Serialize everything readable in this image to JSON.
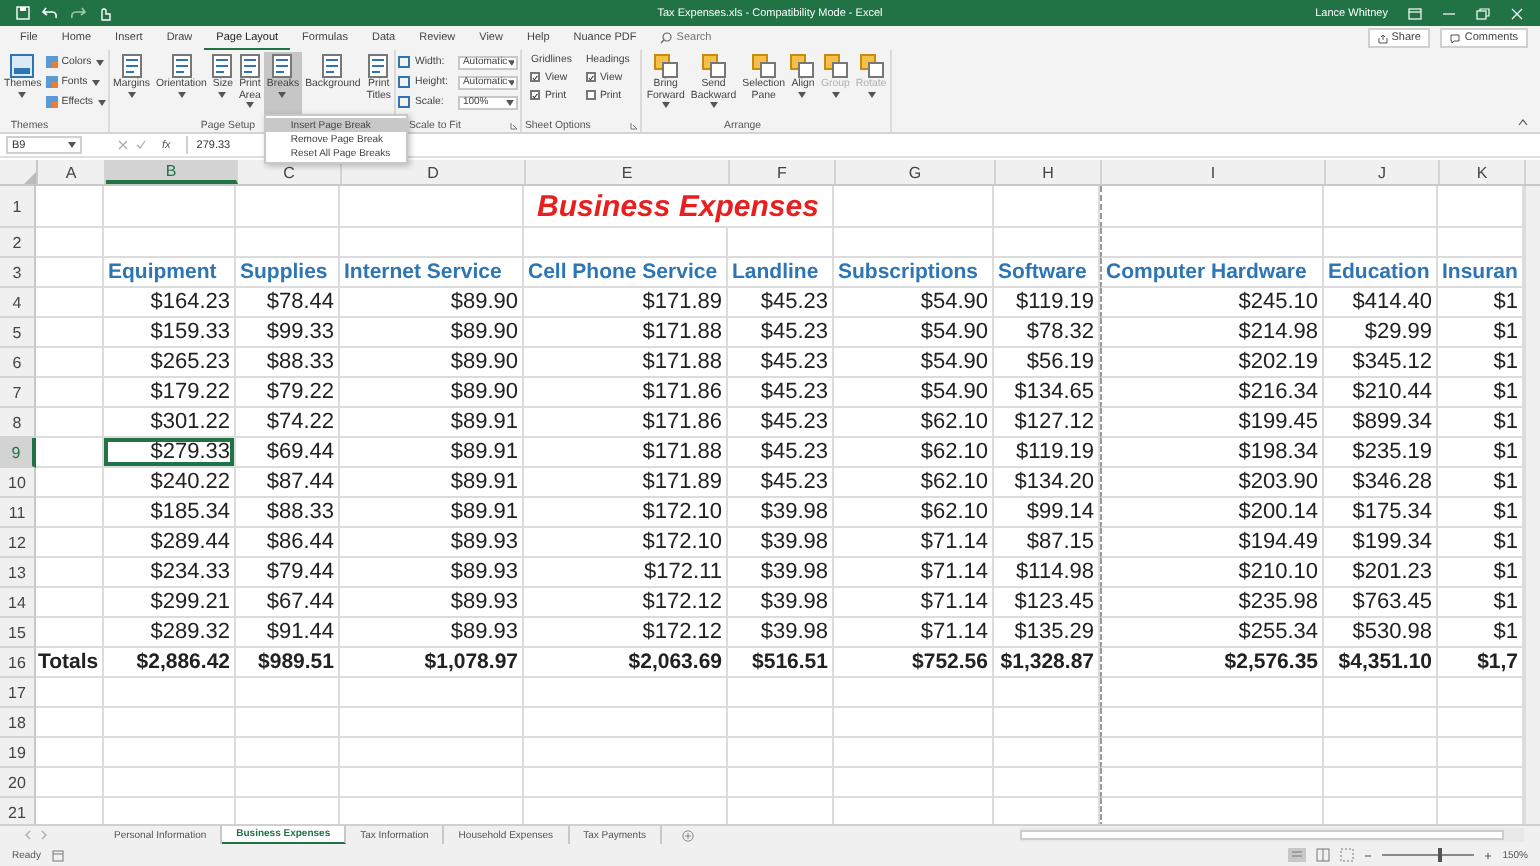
{
  "window": {
    "title": "Tax Expenses.xls  -  Compatibility Mode  -  Excel",
    "user": "Lance Whitney"
  },
  "menu_tabs": [
    {
      "label": "File",
      "selected": false
    },
    {
      "label": "Home",
      "selected": false
    },
    {
      "label": "Insert",
      "selected": false
    },
    {
      "label": "Draw",
      "selected": false
    },
    {
      "label": "Page Layout",
      "selected": true
    },
    {
      "label": "Formulas",
      "selected": false
    },
    {
      "label": "Data",
      "selected": false
    },
    {
      "label": "Review",
      "selected": false
    },
    {
      "label": "View",
      "selected": false
    },
    {
      "label": "Help",
      "selected": false
    },
    {
      "label": "Nuance PDF",
      "selected": false
    }
  ],
  "search": {
    "placeholder": "Search"
  },
  "share_button": "Share",
  "comments_button": "Comments",
  "ribbon": {
    "groups": [
      {
        "label": "Themes",
        "launcher": false,
        "items": [
          {
            "kind": "large",
            "label": "Themes",
            "has_menu": true,
            "selected": false,
            "disabled": false
          },
          {
            "kind": "small",
            "label": "Colors",
            "has_menu": true
          },
          {
            "kind": "small",
            "label": "Fonts",
            "has_menu": true
          },
          {
            "kind": "small",
            "label": "Effects",
            "has_menu": true
          }
        ]
      },
      {
        "label": "Page Setup",
        "launcher": false,
        "items": [
          {
            "kind": "large",
            "label": "Margins",
            "has_menu": true,
            "selected": false,
            "disabled": false
          },
          {
            "kind": "large",
            "label": "Orientation",
            "has_menu": true,
            "selected": false,
            "disabled": false
          },
          {
            "kind": "large",
            "label": "Size",
            "has_menu": true,
            "selected": false,
            "disabled": false
          },
          {
            "kind": "large",
            "label": "Print Area",
            "has_menu": true,
            "selected": false,
            "disabled": false
          },
          {
            "kind": "large",
            "label": "Breaks",
            "has_menu": true,
            "selected": true,
            "disabled": false
          },
          {
            "kind": "large",
            "label": "Background",
            "has_menu": false,
            "selected": false,
            "disabled": false
          },
          {
            "kind": "large",
            "label": "Print Titles",
            "has_menu": false,
            "selected": false,
            "disabled": false
          }
        ]
      },
      {
        "label": "Scale to Fit",
        "launcher": true,
        "items": [
          {
            "kind": "spin",
            "label": "Width:",
            "value": "Automatic"
          },
          {
            "kind": "spin",
            "label": "Height:",
            "value": "Automatic"
          },
          {
            "kind": "spin",
            "label": "Scale:",
            "value": "100%"
          }
        ]
      },
      {
        "label": "Sheet Options",
        "launcher": true,
        "items": [
          {
            "kind": "checkgroup",
            "label": "Gridlines",
            "checks": [
              {
                "label": "View",
                "checked": true
              },
              {
                "label": "Print",
                "checked": true
              }
            ]
          },
          {
            "kind": "checkgroup",
            "label": "Headings",
            "checks": [
              {
                "label": "View",
                "checked": true
              },
              {
                "label": "Print",
                "checked": false
              }
            ]
          }
        ]
      },
      {
        "label": "Arrange",
        "launcher": false,
        "items": [
          {
            "kind": "large",
            "label": "Bring Forward",
            "has_menu": true,
            "selected": false,
            "disabled": false
          },
          {
            "kind": "large",
            "label": "Send Backward",
            "has_menu": true,
            "selected": false,
            "disabled": false
          },
          {
            "kind": "large",
            "label": "Selection Pane",
            "has_menu": false,
            "selected": false,
            "disabled": false
          },
          {
            "kind": "large",
            "label": "Align",
            "has_menu": true,
            "selected": false,
            "disabled": false
          },
          {
            "kind": "large",
            "label": "Group",
            "has_menu": true,
            "selected": false,
            "disabled": true
          },
          {
            "kind": "large",
            "label": "Rotate",
            "has_menu": true,
            "selected": false,
            "disabled": true
          }
        ]
      }
    ]
  },
  "breaks_menu": [
    {
      "label": "Insert Page Break",
      "selected": true
    },
    {
      "label": "Remove Page Break",
      "selected": false
    },
    {
      "label": "Reset All Page Breaks",
      "selected": false
    }
  ],
  "formula_bar": {
    "cell_ref": "B9",
    "function_label": "fx",
    "value": "279.33"
  },
  "sheet": {
    "columns": [
      {
        "letter": "A",
        "selected": false
      },
      {
        "letter": "B",
        "selected": true
      },
      {
        "letter": "C",
        "selected": false
      },
      {
        "letter": "D",
        "selected": false
      },
      {
        "letter": "E",
        "selected": false
      },
      {
        "letter": "F",
        "selected": false
      },
      {
        "letter": "G",
        "selected": false
      },
      {
        "letter": "H",
        "selected": false
      },
      {
        "letter": "I",
        "selected": false
      },
      {
        "letter": "J",
        "selected": false
      },
      {
        "letter": "K",
        "selected": false
      }
    ],
    "rows": [
      {
        "number": "1",
        "kind": "title",
        "selected": false,
        "title": "Business Expenses"
      },
      {
        "number": "2",
        "kind": "empty",
        "selected": false
      },
      {
        "number": "3",
        "kind": "header",
        "selected": false,
        "cells": [
          "Equipment",
          "Supplies",
          "Internet Service",
          "Cell Phone Service",
          "Landline",
          "Subscriptions",
          "Software",
          "Computer Hardware",
          "Education",
          "Insuran"
        ]
      },
      {
        "number": "4",
        "kind": "data",
        "selected": false,
        "cells": [
          "$164.23",
          "$78.44",
          "$89.90",
          "$171.89",
          "$45.23",
          "$54.90",
          "$119.19",
          "$245.10",
          "$414.40",
          "$1"
        ]
      },
      {
        "number": "5",
        "kind": "data",
        "selected": false,
        "cells": [
          "$159.33",
          "$99.33",
          "$89.90",
          "$171.88",
          "$45.23",
          "$54.90",
          "$78.32",
          "$214.98",
          "$29.99",
          "$1"
        ]
      },
      {
        "number": "6",
        "kind": "data",
        "selected": false,
        "cells": [
          "$265.23",
          "$88.33",
          "$89.90",
          "$171.88",
          "$45.23",
          "$54.90",
          "$56.19",
          "$202.19",
          "$345.12",
          "$1"
        ]
      },
      {
        "number": "7",
        "kind": "data",
        "selected": false,
        "cells": [
          "$179.22",
          "$79.22",
          "$89.90",
          "$171.86",
          "$45.23",
          "$54.90",
          "$134.65",
          "$216.34",
          "$210.44",
          "$1"
        ]
      },
      {
        "number": "8",
        "kind": "data",
        "selected": false,
        "cells": [
          "$301.22",
          "$74.22",
          "$89.91",
          "$171.86",
          "$45.23",
          "$62.10",
          "$127.12",
          "$199.45",
          "$899.34",
          "$1"
        ]
      },
      {
        "number": "9",
        "kind": "data",
        "selected": true,
        "cells": [
          "$279.33",
          "$69.44",
          "$89.91",
          "$171.88",
          "$45.23",
          "$62.10",
          "$119.19",
          "$198.34",
          "$235.19",
          "$1"
        ]
      },
      {
        "number": "10",
        "kind": "data",
        "selected": false,
        "cells": [
          "$240.22",
          "$87.44",
          "$89.91",
          "$171.89",
          "$45.23",
          "$62.10",
          "$134.20",
          "$203.90",
          "$346.28",
          "$1"
        ]
      },
      {
        "number": "11",
        "kind": "data",
        "selected": false,
        "cells": [
          "$185.34",
          "$88.33",
          "$89.91",
          "$172.10",
          "$39.98",
          "$62.10",
          "$99.14",
          "$200.14",
          "$175.34",
          "$1"
        ]
      },
      {
        "number": "12",
        "kind": "data",
        "selected": false,
        "cells": [
          "$289.44",
          "$86.44",
          "$89.93",
          "$172.10",
          "$39.98",
          "$71.14",
          "$87.15",
          "$194.49",
          "$199.34",
          "$1"
        ]
      },
      {
        "number": "13",
        "kind": "data",
        "selected": false,
        "cells": [
          "$234.33",
          "$79.44",
          "$89.93",
          "$172.11",
          "$39.98",
          "$71.14",
          "$114.98",
          "$210.10",
          "$201.23",
          "$1"
        ]
      },
      {
        "number": "14",
        "kind": "data",
        "selected": false,
        "cells": [
          "$299.21",
          "$67.44",
          "$89.93",
          "$172.12",
          "$39.98",
          "$71.14",
          "$123.45",
          "$235.98",
          "$763.45",
          "$1"
        ]
      },
      {
        "number": "15",
        "kind": "data",
        "selected": false,
        "cells": [
          "$289.32",
          "$91.44",
          "$89.93",
          "$172.12",
          "$39.98",
          "$71.14",
          "$135.29",
          "$255.34",
          "$530.98",
          "$1"
        ]
      },
      {
        "number": "16",
        "kind": "total",
        "selected": false,
        "label": "Totals",
        "cells": [
          "$2,886.42",
          "$989.51",
          "$1,078.97",
          "$2,063.69",
          "$516.51",
          "$752.56",
          "$1,328.87",
          "$2,576.35",
          "$4,351.10",
          "$1,7"
        ]
      },
      {
        "number": "17",
        "kind": "empty",
        "selected": false
      },
      {
        "number": "18",
        "kind": "empty",
        "selected": false
      },
      {
        "number": "19",
        "kind": "empty",
        "selected": false
      },
      {
        "number": "20",
        "kind": "empty",
        "selected": false
      },
      {
        "number": "21",
        "kind": "empty",
        "selected": false
      }
    ]
  },
  "sheet_tabs": [
    {
      "label": "Personal Information",
      "selected": false
    },
    {
      "label": "Business Expenses",
      "selected": true
    },
    {
      "label": "Tax Information",
      "selected": false
    },
    {
      "label": "Household Expenses",
      "selected": false
    },
    {
      "label": "Tax Payments",
      "selected": false
    }
  ],
  "status_bar": {
    "status": "Ready",
    "zoom": "150%",
    "zoom_slider": {
      "level": 0.6
    }
  }
}
